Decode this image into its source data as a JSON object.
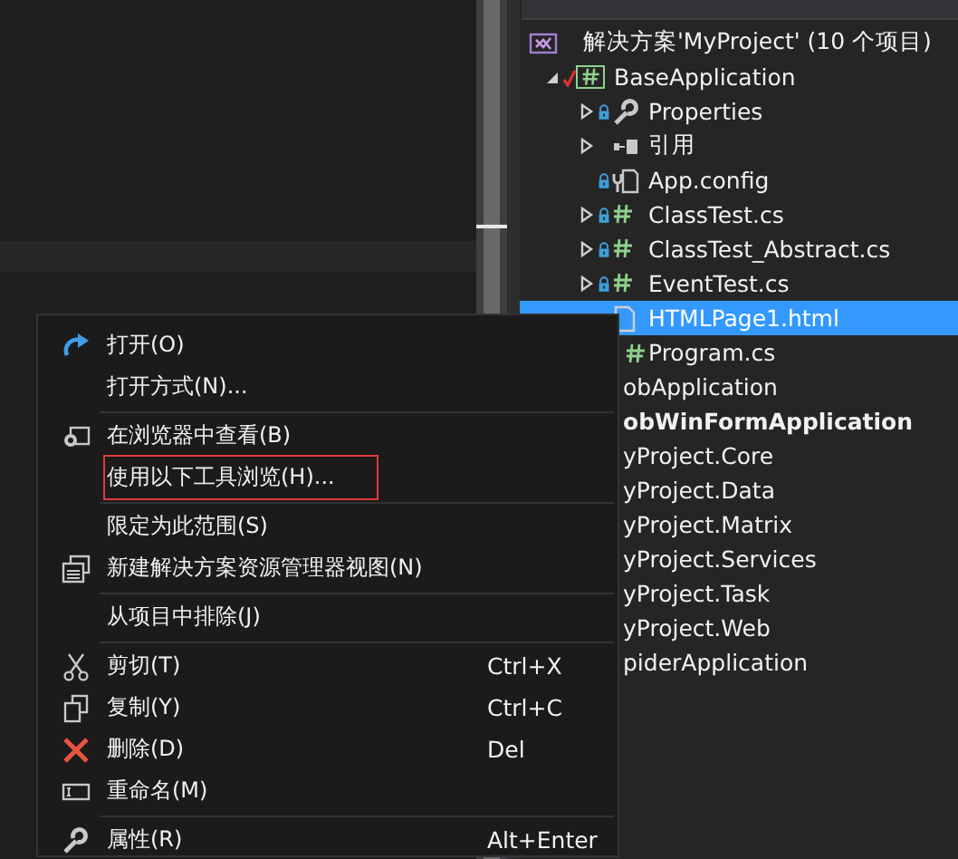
{
  "explorer": {
    "tree": [
      {
        "label": "解决方案'MyProject' (10 个项目)",
        "kind": "solution",
        "selected": false,
        "children": [
          {
            "label": "BaseApplication",
            "kind": "project",
            "expanded": true,
            "selected": false,
            "startup": false,
            "children": [
              {
                "label": "Properties",
                "kind": "properties",
                "expanded": false,
                "selected": false
              },
              {
                "label": "引用",
                "kind": "references",
                "expanded": false,
                "selected": false
              },
              {
                "label": "App.config",
                "kind": "config",
                "selected": false
              },
              {
                "label": "ClassTest.cs",
                "kind": "csharp",
                "expanded": false,
                "selected": false
              },
              {
                "label": "ClassTest_Abstract.cs",
                "kind": "csharp",
                "expanded": false,
                "selected": false
              },
              {
                "label": "EventTest.cs",
                "kind": "csharp",
                "expanded": false,
                "selected": false
              },
              {
                "label": "HTMLPage1.html",
                "kind": "html",
                "selected": true
              },
              {
                "label": "Program.cs",
                "kind": "csharp-clipped",
                "selected": false
              }
            ]
          },
          {
            "label": "obApplication",
            "kind": "clipped",
            "selected": false,
            "startup": false
          },
          {
            "label": "obWinFormApplication",
            "kind": "clipped",
            "selected": false,
            "startup": true
          },
          {
            "label": "yProject.Core",
            "kind": "clipped",
            "selected": false,
            "startup": false
          },
          {
            "label": "yProject.Data",
            "kind": "clipped",
            "selected": false,
            "startup": false
          },
          {
            "label": "yProject.Matrix",
            "kind": "clipped",
            "selected": false,
            "startup": false
          },
          {
            "label": "yProject.Services",
            "kind": "clipped",
            "selected": false,
            "startup": false
          },
          {
            "label": "yProject.Task",
            "kind": "clipped",
            "selected": false,
            "startup": false
          },
          {
            "label": "yProject.Web",
            "kind": "clipped",
            "selected": false,
            "startup": false
          },
          {
            "label": "piderApplication",
            "kind": "clipped",
            "selected": false,
            "startup": false
          }
        ]
      }
    ]
  },
  "context_menu": {
    "groups": [
      [
        {
          "label": "打开(O)",
          "outlined": false
        },
        {
          "label": "打开方式(N)...",
          "outlined": false
        }
      ],
      [
        {
          "label": "在浏览器中查看(B)",
          "outlined": false
        },
        {
          "label": "使用以下工具浏览(H)...",
          "outlined": true
        }
      ],
      [
        {
          "label": "限定为此范围(S)",
          "outlined": false
        },
        {
          "label": "新建解决方案资源管理器视图(N)",
          "outlined": false
        }
      ],
      [
        {
          "label": "从项目中排除(J)",
          "outlined": false
        }
      ],
      [
        {
          "label": "剪切(T)",
          "shortcut": "Ctrl+X",
          "outlined": false
        },
        {
          "label": "复制(Y)",
          "shortcut": "Ctrl+C",
          "outlined": false
        },
        {
          "label": "删除(D)",
          "shortcut": "Del",
          "outlined": false
        },
        {
          "label": "重命名(M)",
          "outlined": false
        }
      ],
      [
        {
          "label": "属性(R)",
          "shortcut": "Alt+Enter",
          "outlined": false
        }
      ]
    ]
  }
}
